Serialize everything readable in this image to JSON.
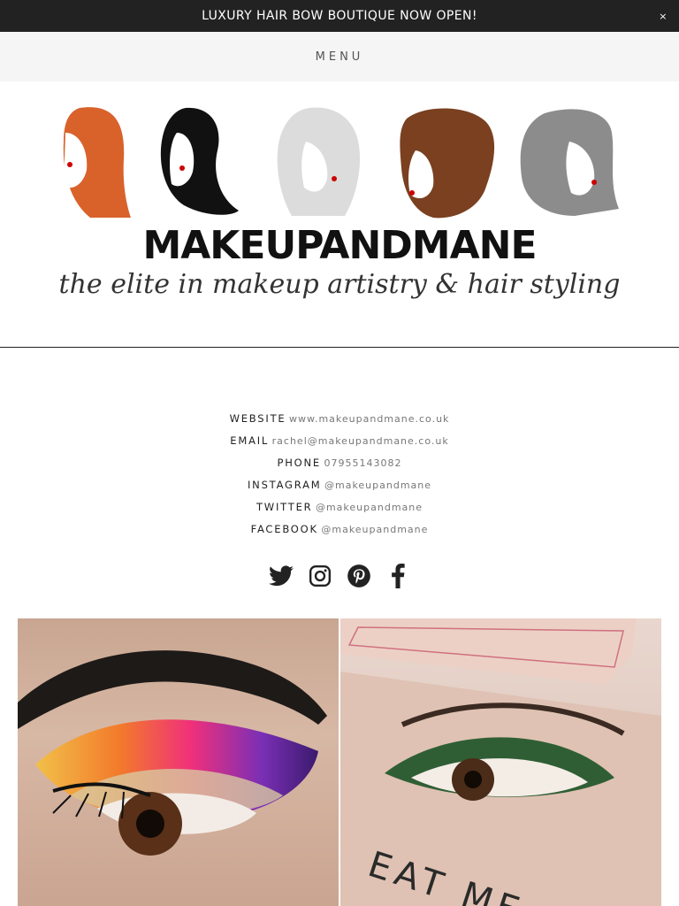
{
  "announcement": {
    "text": "LUXURY HAIR BOW BOUTIQUE NOW OPEN!",
    "close_label": "×"
  },
  "nav": {
    "menu_label": "MENU"
  },
  "brand": {
    "name": "MAKEUPANDMANE",
    "tagline": "the elite in makeup artistry & hair styling"
  },
  "contact": [
    {
      "label": "WEBSITE",
      "value": "www.makeupandmane.co.uk"
    },
    {
      "label": "EMAIL",
      "value": "rachel@makeupandmane.co.uk"
    },
    {
      "label": "PHONE",
      "value": "07955143082"
    },
    {
      "label": "INSTAGRAM",
      "value": "@makeupandmane"
    },
    {
      "label": "TWITTER",
      "value": "@makeupandmane"
    },
    {
      "label": "FACEBOOK",
      "value": "@makeupandmane"
    }
  ],
  "social_icons": [
    "twitter-icon",
    "instagram-icon",
    "pinterest-icon",
    "facebook-icon"
  ],
  "gallery": {
    "image2_caption": "EAT ME"
  },
  "colors": {
    "announcement_bg": "#222222",
    "menu_bg": "#f5f5f5",
    "text": "#222222",
    "muted": "#777777"
  }
}
